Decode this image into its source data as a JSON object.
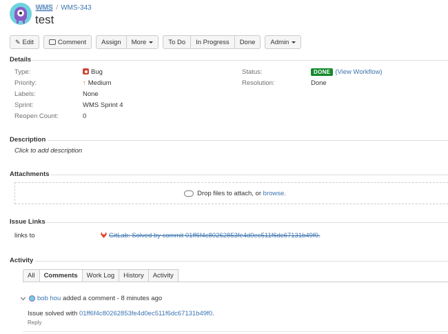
{
  "header": {
    "project": "WMS",
    "separator": "/",
    "issue_key": "WMS-343",
    "title": "test"
  },
  "toolbar": {
    "edit": "Edit",
    "comment": "Comment",
    "assign": "Assign",
    "more": "More",
    "todo": "To Do",
    "in_progress": "In Progress",
    "done": "Done",
    "admin": "Admin"
  },
  "details": {
    "heading": "Details",
    "type_label": "Type:",
    "type_value": "Bug",
    "priority_label": "Priority:",
    "priority_value": "Medium",
    "labels_label": "Labels:",
    "labels_value": "None",
    "sprint_label": "Sprint:",
    "sprint_value": "WMS Sprint 4",
    "reopen_label": "Reopen Count:",
    "reopen_value": "0",
    "status_label": "Status:",
    "status_value": "DONE",
    "view_workflow": "(View Workflow)",
    "resolution_label": "Resolution:",
    "resolution_value": "Done",
    "colors": {
      "bug": "#d04437",
      "priority": "#e8702a",
      "done": "#14892c"
    }
  },
  "description": {
    "heading": "Description",
    "placeholder": "Click to add description"
  },
  "attachments": {
    "heading": "Attachments",
    "drop_text": "Drop files to attach, or",
    "browse": "browse."
  },
  "issue_links": {
    "heading": "Issue Links",
    "relation": "links to",
    "link_text": "GitLab: Solved by commit 01ff6f4c80262853fe4d0ec511f6dc67131b49f0."
  },
  "activity": {
    "heading": "Activity",
    "tabs": [
      "All",
      "Comments",
      "Work Log",
      "History",
      "Activity"
    ],
    "active_tab": "Comments",
    "comment": {
      "author": "bob hou",
      "action": "added a comment - 8 minutes ago",
      "body_prefix": "Issue solved with",
      "commit": "01ff6f4c80262853fe4d0ec511f6dc67131b49f0",
      "body_suffix": ".",
      "reply": "Reply"
    }
  }
}
